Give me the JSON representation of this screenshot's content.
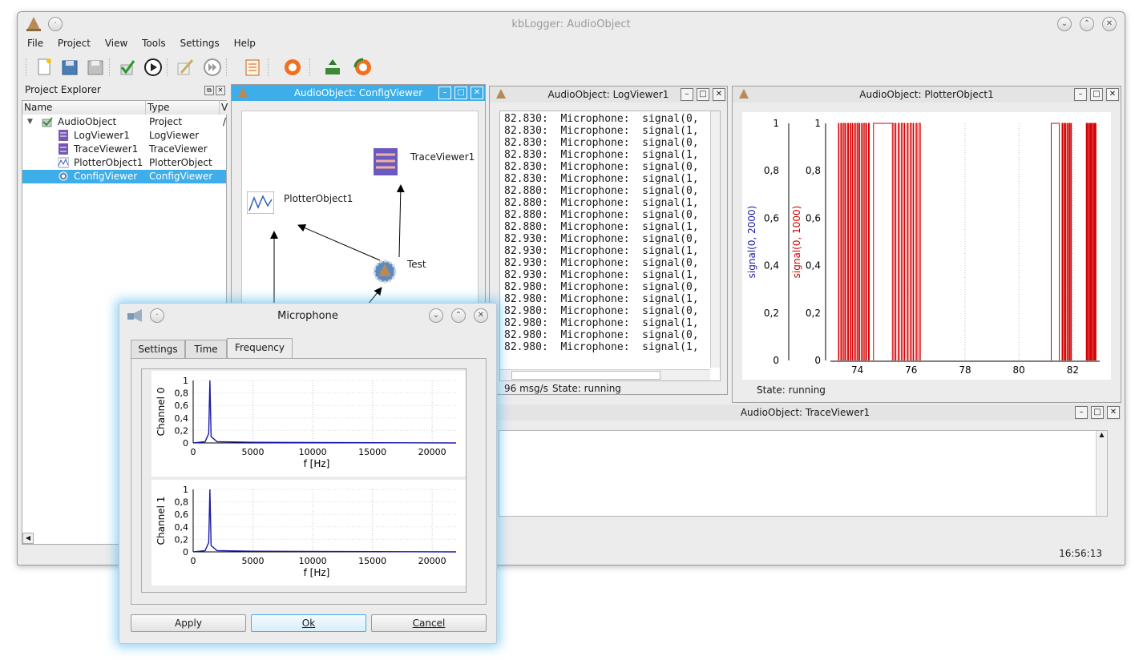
{
  "window": {
    "title": "kbLogger: AudioObject"
  },
  "menu": [
    "File",
    "Project",
    "View",
    "Tools",
    "Settings",
    "Help"
  ],
  "explorer": {
    "title": "Project Explorer",
    "columns": [
      "Name",
      "Type",
      "V"
    ],
    "rows": [
      {
        "name": "AudioObject",
        "type": "Project",
        "v": "/"
      },
      {
        "name": "LogViewer1",
        "type": "LogViewer",
        "v": ""
      },
      {
        "name": "TraceViewer1",
        "type": "TraceViewer",
        "v": ""
      },
      {
        "name": "PlotterObject1",
        "type": "PlotterObject",
        "v": ""
      },
      {
        "name": "ConfigViewer",
        "type": "ConfigViewer",
        "v": ""
      }
    ]
  },
  "config_viewer": {
    "title": "AudioObject: ConfigViewer",
    "nodes": {
      "trace": "TraceViewer1",
      "plotter": "PlotterObject1",
      "test": "Test"
    }
  },
  "log_viewer": {
    "title": "AudioObject: LogViewer1",
    "lines": [
      "82.830:  Microphone:  signal(0,",
      "82.830:  Microphone:  signal(1,",
      "82.830:  Microphone:  signal(0,",
      "82.830:  Microphone:  signal(1,",
      "82.830:  Microphone:  signal(0,",
      "82.830:  Microphone:  signal(1,",
      "82.880:  Microphone:  signal(0,",
      "82.880:  Microphone:  signal(1,",
      "82.880:  Microphone:  signal(0,",
      "82.880:  Microphone:  signal(1,",
      "82.930:  Microphone:  signal(0,",
      "82.930:  Microphone:  signal(1,",
      "82.930:  Microphone:  signal(0,",
      "82.930:  Microphone:  signal(1,",
      "82.980:  Microphone:  signal(0,",
      "82.980:  Microphone:  signal(1,",
      "82.980:  Microphone:  signal(0,",
      "82.980:  Microphone:  signal(1,",
      "82.980:  Microphone:  signal(0,",
      "82.980:  Microphone:  signal(1,"
    ],
    "rate": "96 msg/s",
    "state": "State: running"
  },
  "plotter": {
    "title": "AudioObject: PlotterObject1",
    "state": "State: running",
    "y_ticks": [
      "1",
      "0,8",
      "0,6",
      "0,4",
      "0,2",
      "0"
    ],
    "x_ticks": [
      "74",
      "76",
      "78",
      "80",
      "82"
    ],
    "ylabel_blue": "signal(0, 2000)",
    "ylabel_red": "signal(0, 1000)"
  },
  "trace_viewer": {
    "title": "AudioObject: TraceViewer1"
  },
  "clock": "16:56:13",
  "dialog": {
    "title": "Microphone",
    "tabs": [
      "Settings",
      "Time",
      "Frequency"
    ],
    "active_tab": "Frequency",
    "plots": [
      {
        "ylabel": "Channel 0",
        "xlabel": "f [Hz]"
      },
      {
        "ylabel": "Channel 1",
        "xlabel": "f [Hz]"
      }
    ],
    "y_ticks": [
      "1",
      "0,8",
      "0,6",
      "0,4",
      "0,2",
      "0"
    ],
    "x_ticks": [
      "0",
      "5000",
      "10000",
      "15000",
      "20000"
    ],
    "buttons": {
      "apply": "Apply",
      "ok": "Ok",
      "cancel": "Cancel"
    }
  },
  "colors": {
    "accent": "#3daee9",
    "signal_red": "#d40000",
    "signal_blue": "#1a1aa6"
  },
  "chart_data": [
    {
      "type": "line",
      "title": "",
      "series": [
        {
          "name": "signal(0, 1000)",
          "color": "#d40000",
          "note": "square-wave bursts between 0 and 1"
        }
      ],
      "ylabel": "signal(0, 1000)",
      "xlim": [
        73,
        83
      ],
      "ylim": [
        0,
        1
      ],
      "x_ticks": [
        74,
        76,
        78,
        80,
        82
      ],
      "y_ticks": [
        0,
        0.2,
        0.4,
        0.6,
        0.8,
        1
      ],
      "grid": true
    },
    {
      "type": "line",
      "ylabel": "Channel 0",
      "xlabel": "f [Hz]",
      "x": [
        0,
        1000,
        1300,
        1400,
        1500,
        2000,
        5000,
        22000
      ],
      "values": [
        0,
        0.02,
        0.15,
        1.0,
        0.1,
        0.02,
        0.01,
        0.0
      ],
      "xlim": [
        0,
        22000
      ],
      "ylim": [
        0,
        1
      ],
      "grid": true
    },
    {
      "type": "line",
      "ylabel": "Channel 1",
      "xlabel": "f [Hz]",
      "x": [
        0,
        1000,
        1300,
        1400,
        1500,
        2000,
        5000,
        22000
      ],
      "values": [
        0,
        0.02,
        0.15,
        1.0,
        0.1,
        0.02,
        0.01,
        0.0
      ],
      "xlim": [
        0,
        22000
      ],
      "ylim": [
        0,
        1
      ],
      "grid": true
    }
  ]
}
